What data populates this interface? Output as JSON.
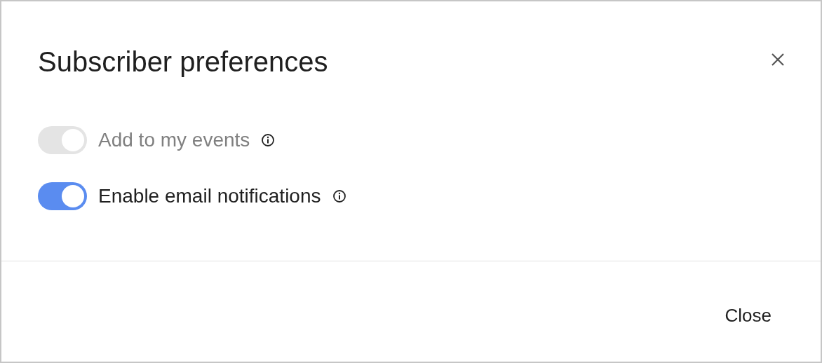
{
  "dialog": {
    "title": "Subscriber preferences",
    "toggles": [
      {
        "label": "Add to my events",
        "on": true,
        "disabled": true
      },
      {
        "label": "Enable email notifications",
        "on": true,
        "disabled": false
      }
    ],
    "buttons": [
      "Close"
    ]
  }
}
